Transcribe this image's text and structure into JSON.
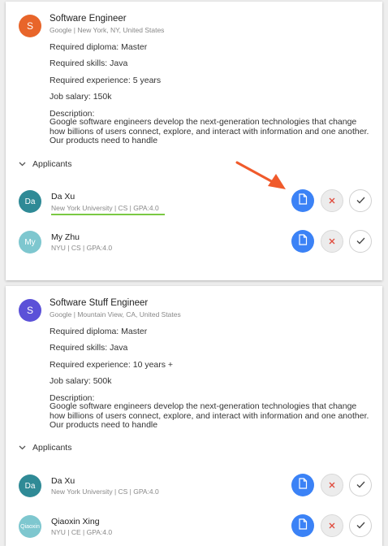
{
  "colors": {
    "primary": "#3b82f6",
    "reject": "#e04a3c",
    "highlight": "#7ac943",
    "annotation_arrow": "#f05a2b"
  },
  "jobs": [
    {
      "avatar_letter": "S",
      "avatar_color": "#e8652a",
      "title": "Software Engineer",
      "subtitle": "Google | New York, NY, United States",
      "diploma": "Required diploma: Master",
      "skills": "Required skills: Java",
      "experience": "Required experience: 5 years",
      "salary": "Job salary: 150k",
      "description_label": "Description:",
      "description": "Google software engineers develop the next-generation technologies that change how billions of users connect, explore, and interact with information and one another. Our products need to handle",
      "applicants_label": "Applicants",
      "applicants": [
        {
          "initials": "Da",
          "avatar_color": "#2f8a96",
          "name": "Da Xu",
          "details": "New York University | CS | GPA:4.0"
        },
        {
          "initials": "My",
          "avatar_color": "#7ec7cf",
          "name": "My Zhu",
          "details": "NYU | CS | GPA:4.0"
        }
      ]
    },
    {
      "avatar_letter": "S",
      "avatar_color": "#5b51d8",
      "title": "Software Stuff Engineer",
      "subtitle": "Google | Mountain View, CA, United States",
      "diploma": "Required diploma: Master",
      "skills": "Required skills: Java",
      "experience": "Required experience: 10 years +",
      "salary": "Job salary: 500k",
      "description_label": "Description:",
      "description": "Google software engineers develop the next-generation technologies that change how billions of users connect, explore, and interact with information and one another. Our products need to handle",
      "applicants_label": "Applicants",
      "applicants": [
        {
          "initials": "Da",
          "avatar_color": "#2f8a96",
          "name": "Da Xu",
          "details": "New York University | CS | GPA:4.0"
        },
        {
          "initials": "Qiaoxin",
          "avatar_color": "#7ec7cf",
          "name": "Qiaoxin Xing",
          "details": "NYU | CE | GPA:4.0"
        }
      ]
    }
  ],
  "icons": {
    "document": "document-icon",
    "reject": "close-icon",
    "accept": "check-icon",
    "expand": "chevron-down-icon"
  }
}
